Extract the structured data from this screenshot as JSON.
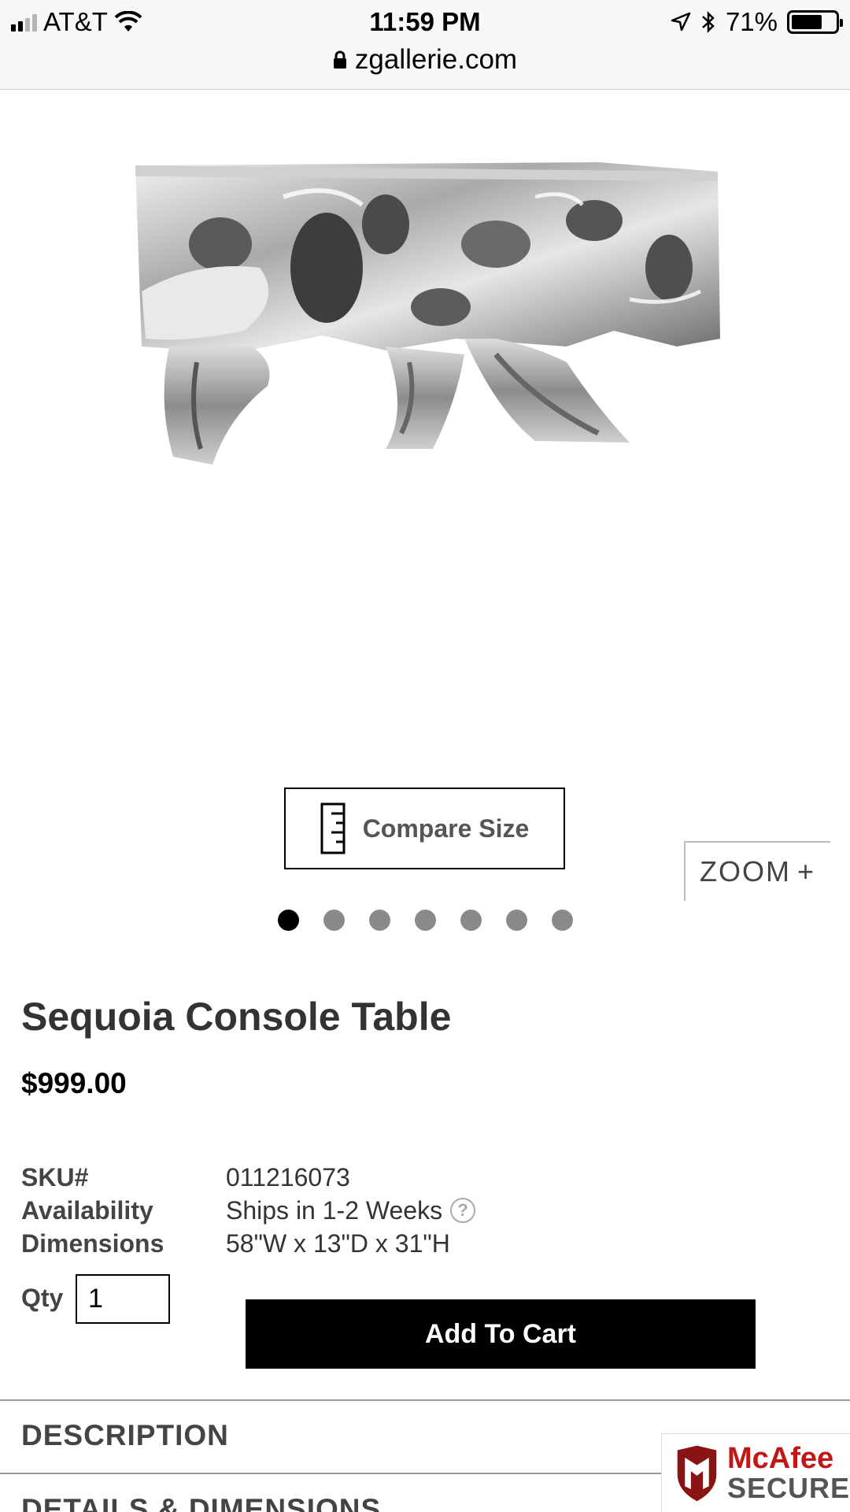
{
  "status_bar": {
    "carrier": "AT&T",
    "time": "11:59 PM",
    "battery": "71%",
    "battery_level": 0.71
  },
  "url_bar": {
    "domain": "zgallerie.com"
  },
  "gallery": {
    "compare_label": "Compare Size",
    "zoom_label": "ZOOM",
    "zoom_plus": "+",
    "image_count": 7,
    "active_index": 0
  },
  "product": {
    "title": "Sequoia Console Table",
    "price": "$999.00",
    "specs": [
      {
        "label": "SKU#",
        "value": "011216073"
      },
      {
        "label": "Availability",
        "value": "Ships in 1-2 Weeks"
      },
      {
        "label": "Dimensions",
        "value": "58\"W x 13\"D x 31\"H"
      }
    ],
    "qty_label": "Qty",
    "qty_value": "1",
    "add_to_cart": "Add To Cart"
  },
  "sections": [
    {
      "label": "DESCRIPTION"
    },
    {
      "label": "DETAILS & DIMENSIONS"
    }
  ],
  "badge": {
    "brand": "McAfee",
    "tag": "SECURE"
  },
  "colors": {
    "button_bg": "#000000",
    "mcafee_red": "#c01818"
  }
}
